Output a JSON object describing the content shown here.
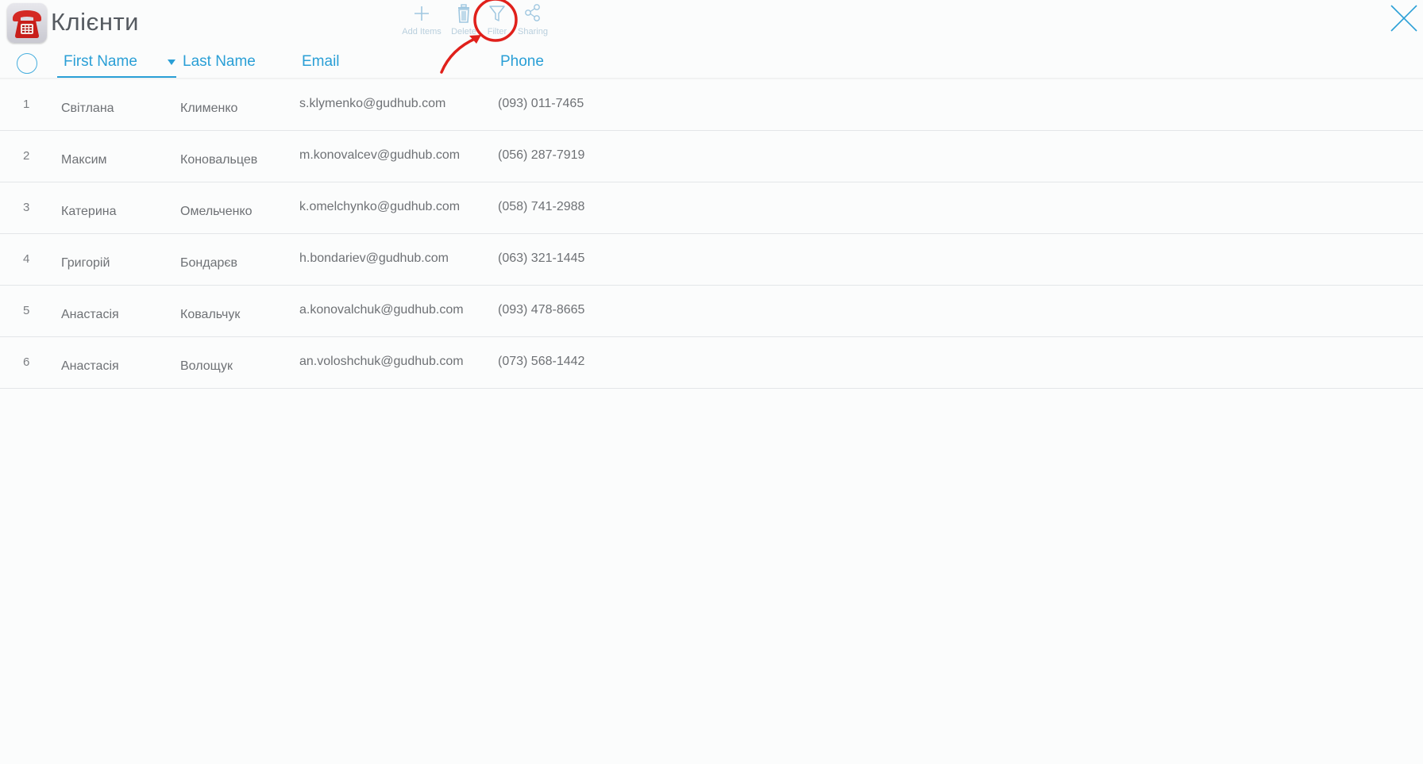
{
  "app": {
    "title": "Клієнти",
    "icon": "red-telephone-icon"
  },
  "toolbar": {
    "add_label": "Add Items",
    "delete_label": "Delete",
    "filter_label": "Filter",
    "sharing_label": "Sharing"
  },
  "columns": {
    "first_name": "First Name",
    "last_name": "Last Name",
    "email": "Email",
    "phone": "Phone",
    "sorted_by": "First Name"
  },
  "rows": [
    {
      "num": "1",
      "first": "Світлана",
      "last": "Клименко",
      "email": "s.klymenko@gudhub.com",
      "phone": "(093) 011-7465"
    },
    {
      "num": "2",
      "first": "Максим",
      "last": "Коновальцев",
      "email": "m.konovalcev@gudhub.com",
      "phone": "(056) 287-7919"
    },
    {
      "num": "3",
      "first": "Катерина",
      "last": "Омельченко",
      "email": "k.omelchynko@gudhub.com",
      "phone": "(058) 741-2988"
    },
    {
      "num": "4",
      "first": "Григорій",
      "last": "Бондарєв",
      "email": "h.bondariev@gudhub.com",
      "phone": "(063) 321-1445"
    },
    {
      "num": "5",
      "first": "Анастасія",
      "last": "Ковальчук",
      "email": "a.konovalchuk@gudhub.com",
      "phone": "(093) 478-8665"
    },
    {
      "num": "6",
      "first": "Анастасія",
      "last": "Волощук",
      "email": "an.voloshchuk@gudhub.com",
      "phone": "(073) 568-1442"
    }
  ],
  "colors": {
    "accent": "#2a9fd6",
    "annotation": "#e0201b",
    "toolbar_icon": "#9fc7e0"
  }
}
